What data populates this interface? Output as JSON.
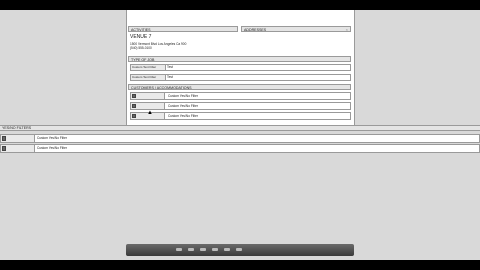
{
  "panel": {
    "section_left": "ACTIVITIES",
    "section_right": "ADDRESSES",
    "venue": {
      "name": "VENUE 7",
      "address": "1500 Vermont Blvd Los Angeles Ca 900",
      "phone": "(540) 555-0100"
    },
    "type_section": "TYPE OF JOB",
    "fields": [
      {
        "label": "Custom Text Filter",
        "value": "Test"
      },
      {
        "label": "Custom Text Filter",
        "value": "Test"
      }
    ],
    "customers_section": "CUSTOMERS / ACCOMMODATIONS",
    "custom_rows": [
      {
        "text": "Custom Yes/No Filter"
      },
      {
        "text": "Custom Yes/No Filter"
      },
      {
        "text": "Custom Yes/No Filter"
      }
    ]
  },
  "lower": {
    "strip_label": "YES/NO FILTERS",
    "rows": [
      {
        "text": "Custom Yes/No Filter"
      },
      {
        "text": "Custom Yes/No Filter"
      }
    ]
  }
}
